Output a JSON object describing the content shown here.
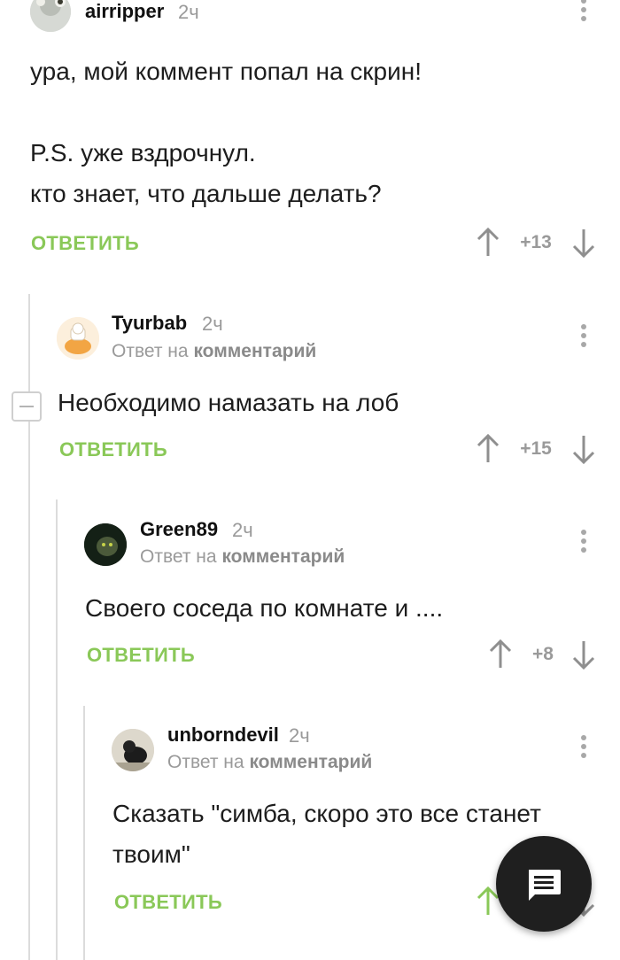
{
  "comments": [
    {
      "username": "airripper",
      "time": "2ч",
      "lines": [
        "ура, мой коммент попал на скрин!",
        "",
        "P.S. уже вздрочнул.",
        "кто знает, что дальше делать?"
      ],
      "reply_label": "ОТВЕТИТЬ",
      "score": "+13"
    },
    {
      "username": "Tyurbab",
      "time": "2ч",
      "reply_to_prefix": "Ответ на",
      "reply_to_link": "комментарий",
      "lines": [
        "Необходимо намазать на лоб"
      ],
      "reply_label": "ОТВЕТИТЬ",
      "score": "+15"
    },
    {
      "username": "Green89",
      "time": "2ч",
      "reply_to_prefix": "Ответ на",
      "reply_to_link": "комментарий",
      "lines": [
        "Своего соседа по комнате и ...."
      ],
      "reply_label": "ОТВЕТИТЬ",
      "score": "+8"
    },
    {
      "username": "unborndevil",
      "time": "2ч",
      "reply_to_prefix": "Ответ на",
      "reply_to_link": "комментарий",
      "lines": [
        "Сказать \"симба, скоро это все станет",
        "твоим\""
      ],
      "reply_label": "ОТВЕТИТЬ"
    }
  ],
  "fab": {
    "icon": "comment-icon"
  },
  "colors": {
    "accent": "#8ac858",
    "muted": "#9a9a9a",
    "fab": "#1f1f1f"
  }
}
